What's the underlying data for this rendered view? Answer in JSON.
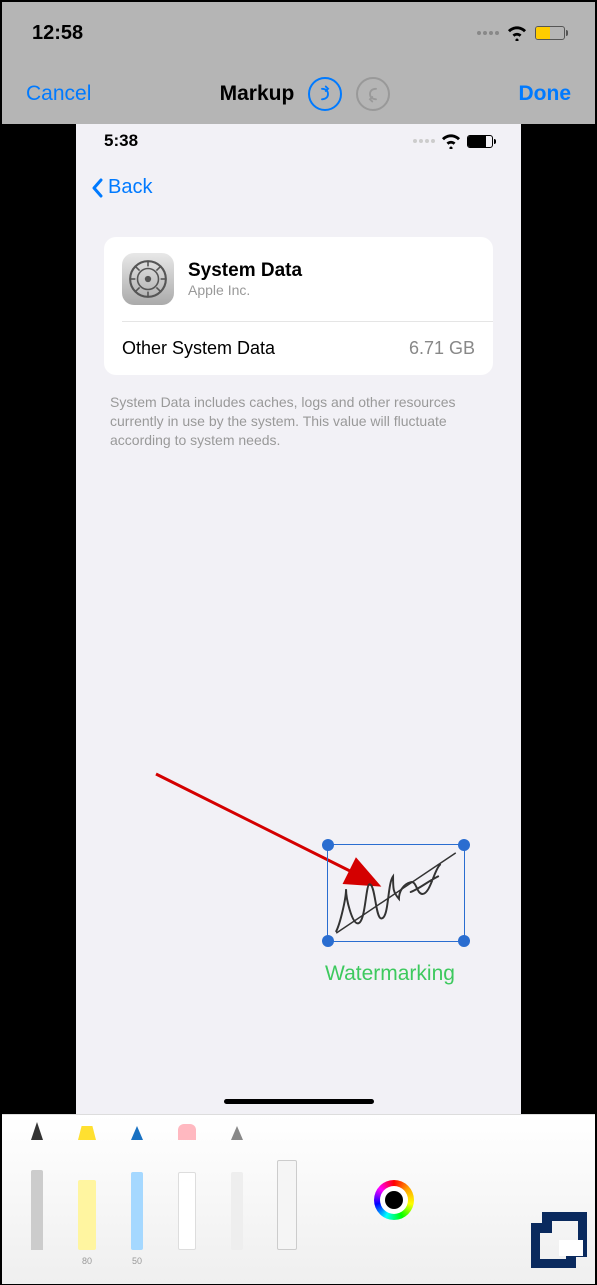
{
  "outer": {
    "time": "12:58"
  },
  "nav": {
    "cancel": "Cancel",
    "title": "Markup",
    "done": "Done"
  },
  "inner": {
    "time": "5:38",
    "back": "Back",
    "card": {
      "title": "System Data",
      "subtitle": "Apple Inc.",
      "row_label": "Other System Data",
      "row_value": "6.71 GB"
    },
    "footnote": "System Data includes caches, logs and other resources currently in use by the system. This value will fluctuate according to system needs.",
    "signature_text": "Water",
    "watermark_label": "Watermarking"
  },
  "tools": {
    "highlighter_size": "80",
    "pencil_size": "50"
  }
}
